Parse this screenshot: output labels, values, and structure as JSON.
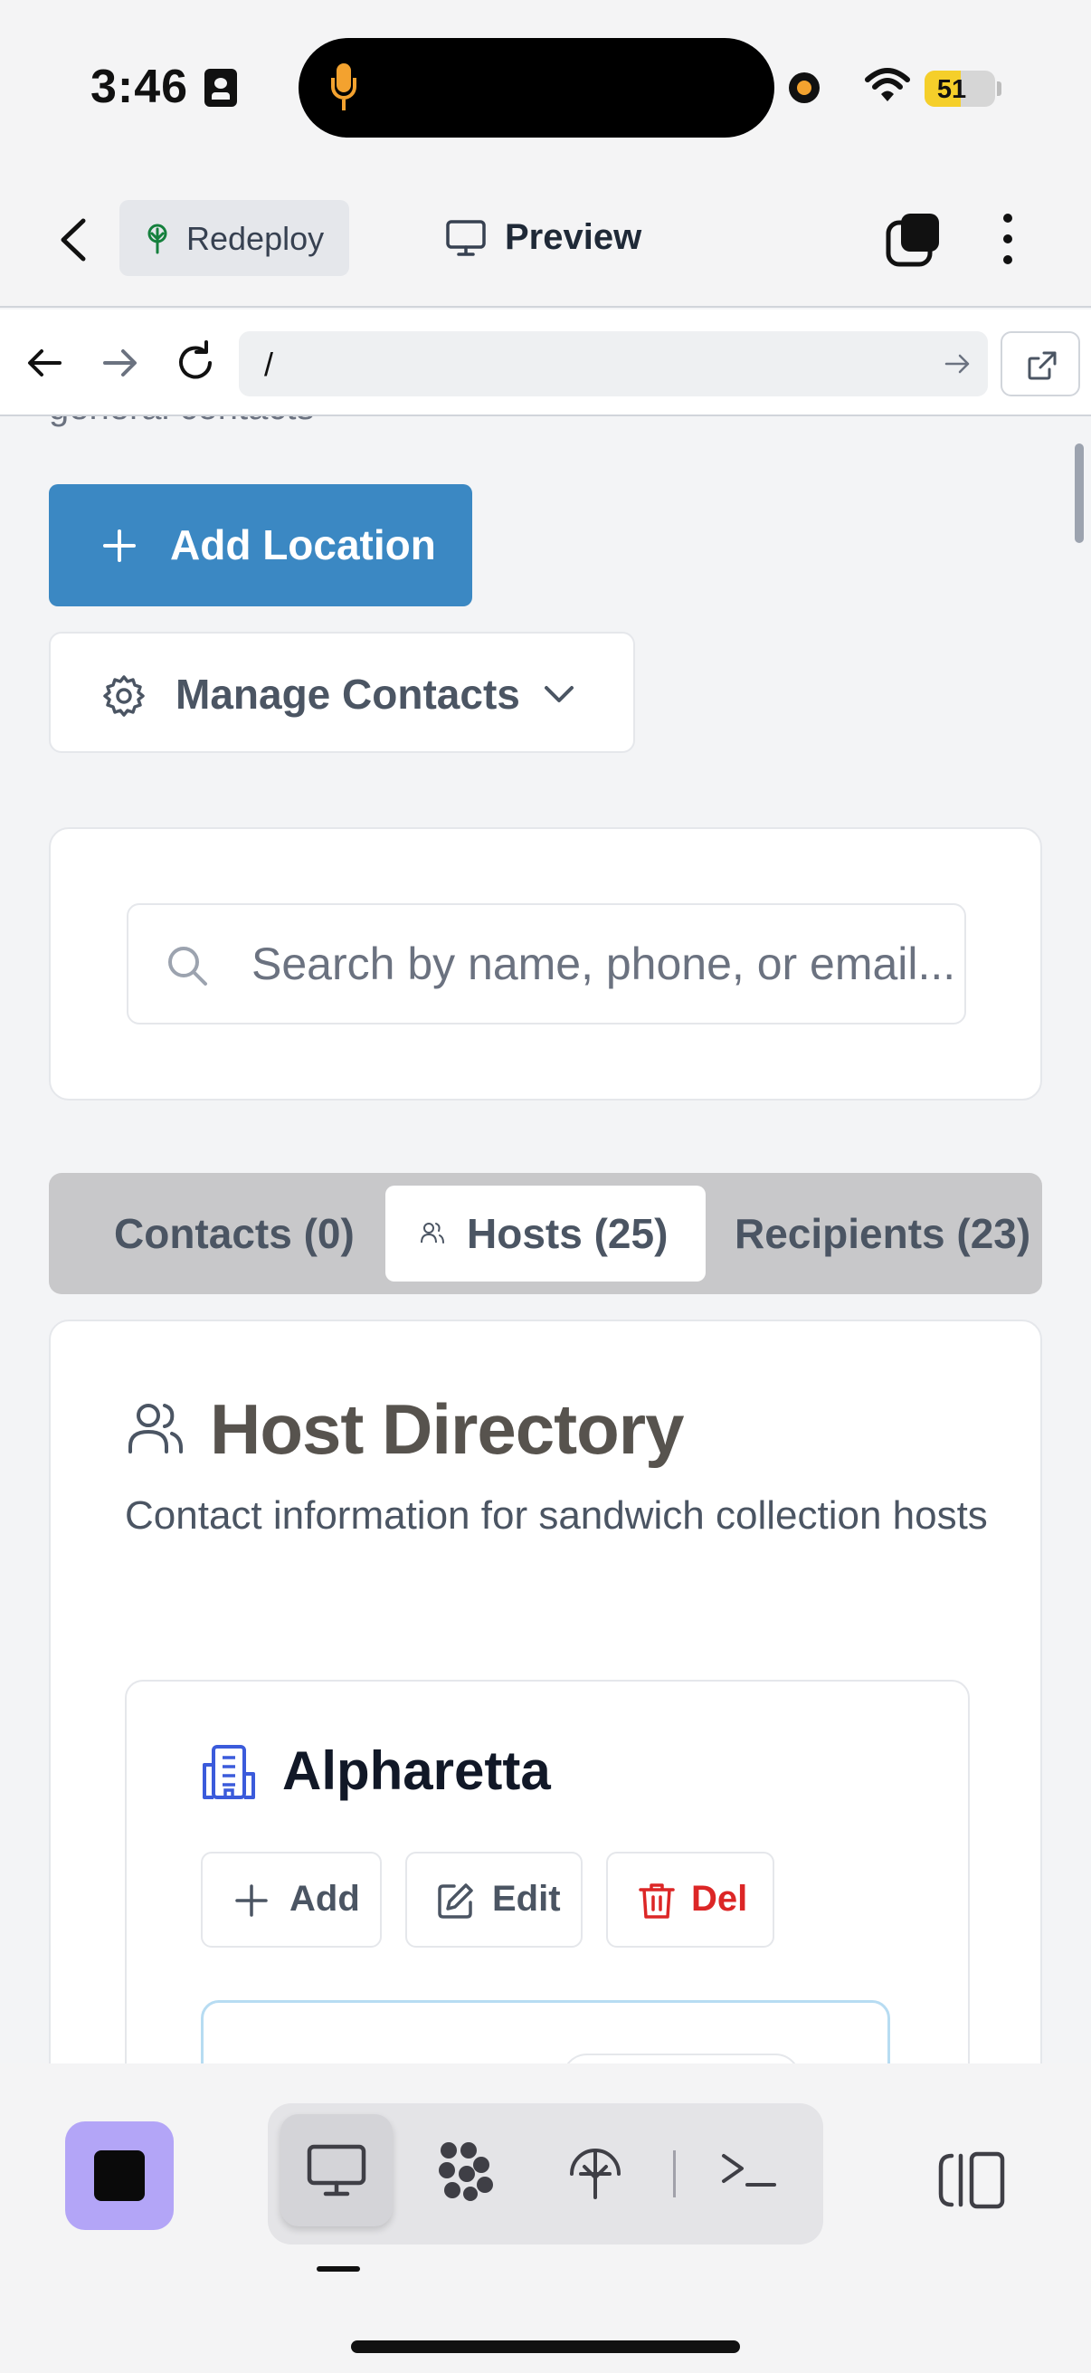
{
  "status_bar": {
    "time": "3:46",
    "battery_percent": "51",
    "battery_level": 0.51,
    "icons": [
      "id-card-icon",
      "microphone-icon",
      "recording-dot-icon",
      "wifi-icon",
      "battery-icon"
    ]
  },
  "header": {
    "redeploy_label": "Redeploy",
    "preview_label": "Preview",
    "icons": [
      "back-chevron-icon",
      "tree-icon",
      "monitor-icon",
      "tabs-icon",
      "more-vertical-icon"
    ]
  },
  "browser": {
    "url": "/",
    "icons": [
      "arrow-left-icon",
      "arrow-right-icon",
      "reload-icon",
      "go-arrow-icon",
      "external-link-icon"
    ]
  },
  "page": {
    "cut_off_text": "general contacts",
    "add_location_label": "Add Location",
    "manage_contacts_label": "Manage Contacts",
    "search_placeholder": "Search by name, phone, or email...",
    "search_value": "",
    "tabs": [
      {
        "label": "Contacts (0)",
        "active": false
      },
      {
        "label": "Hosts (25)",
        "active": true
      },
      {
        "label": "Recipients (23)",
        "active": false
      }
    ],
    "directory": {
      "title": "Host Directory",
      "subtitle": "Contact information for sandwich collection hosts",
      "location": {
        "name": "Alpharetta",
        "actions": {
          "add": "Add",
          "edit": "Edit",
          "delete": "Del"
        }
      }
    }
  },
  "colors": {
    "primary": "#3b88c3",
    "danger": "#dc2626",
    "building_icon": "#3b5bdb",
    "stop_button": "#b3a5f7",
    "battery_fill": "#f5cf2a",
    "mic_accent": "#f3a22f"
  },
  "dock": {
    "items": [
      "monitor-icon",
      "workspace-dots-icon",
      "deploy-icon",
      "terminal-icon"
    ],
    "active_item": "monitor-icon",
    "right_icon": "side-panel-icon"
  }
}
